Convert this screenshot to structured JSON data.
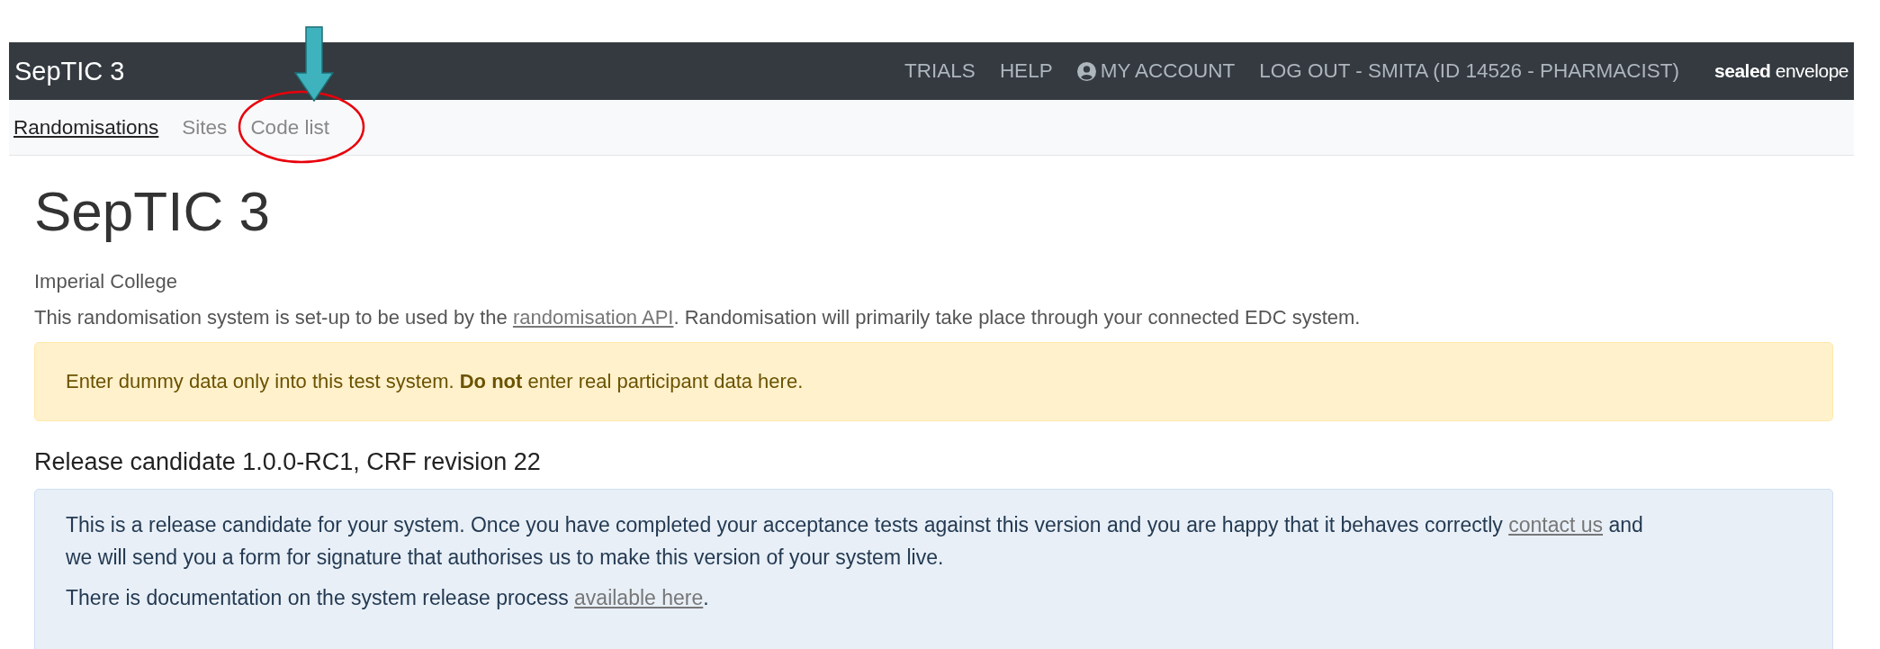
{
  "navbar": {
    "brand": "SepTIC 3",
    "links": [
      {
        "label": "TRIALS",
        "icon": false
      },
      {
        "label": "HELP",
        "icon": false
      },
      {
        "label": "MY ACCOUNT",
        "icon": true
      },
      {
        "label": "LOG OUT - SMITA (ID 14526 - PHARMACIST)",
        "icon": false
      }
    ],
    "logo": "**sealed** envelope"
  },
  "subnav": [
    {
      "label": "Randomisations",
      "selected": true,
      "annotated": false
    },
    {
      "label": "Sites",
      "selected": false,
      "annotated": false
    },
    {
      "label": "Code list",
      "selected": false,
      "annotated": true
    }
  ],
  "page": {
    "title": "SepTIC 3",
    "organisation": "Imperial College",
    "intro": {
      "before": "This randomisation system is set-up to be used by the ",
      "link": "randomisation API",
      "after": ". Randomisation will primarily take place through your connected EDC system."
    },
    "warning": "Enter dummy data only into this test system. **Do not** enter real participant data here.",
    "release_heading": "Release candidate 1.0.0-RC1, CRF revision 22",
    "release_paragraphs": [
      {
        "before": "This is a release candidate for your system. Once you have completed your acceptance tests against this version and you are happy that it behaves correctly ",
        "link": "contact us",
        "after": " and we will send you a form for signature that authorises us to make this version of your system live."
      },
      {
        "before": "There is documentation on the system release process ",
        "link": "available here",
        "after": "."
      }
    ]
  }
}
